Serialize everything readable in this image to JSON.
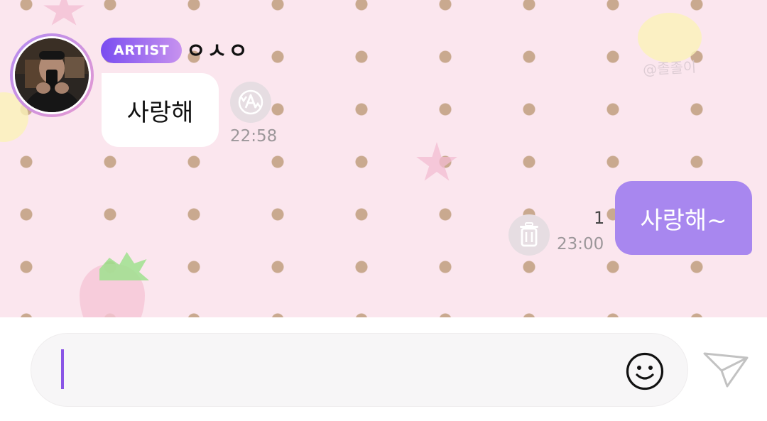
{
  "artist_message": {
    "badge": "ARTIST",
    "name": "ㅇㅅㅇ",
    "text": "사랑해",
    "time": "22:58",
    "translate_icon": "translate-a-icon"
  },
  "my_message": {
    "text": "사랑해~",
    "unread_count": "1",
    "time": "23:00",
    "delete_icon": "trash-icon"
  },
  "composer": {
    "value": "",
    "placeholder": "",
    "emoji_icon": "smiley-icon",
    "send_icon": "paper-plane-icon"
  },
  "background": {
    "watermark": "@졸졸이"
  },
  "colors": {
    "accent": "#a887ef",
    "badge_start": "#7a4df0",
    "badge_end": "#c792ef",
    "chat_background": "#fbe6ee"
  }
}
